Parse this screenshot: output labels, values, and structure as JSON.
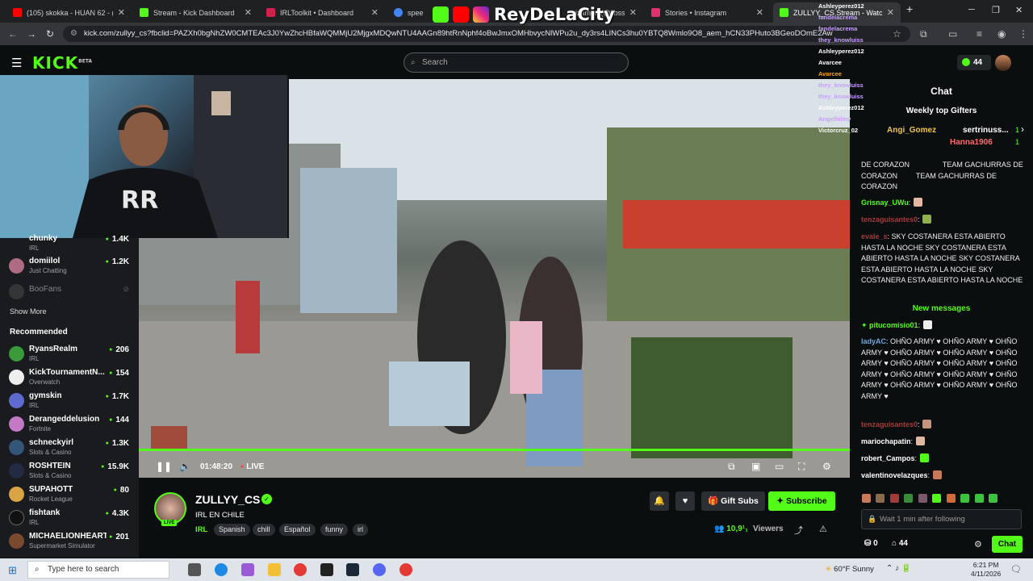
{
  "browser": {
    "tabs": [
      {
        "label": "(105) skokka - HUAN 62 - (Video)",
        "fav_color": "#ff0000",
        "active": false
      },
      {
        "label": "Stream - Kick Dashboard",
        "fav_color": "#53fc18",
        "active": false
      },
      {
        "label": "IRLToolkit • Dashboard",
        "fav_color": "#d1204b",
        "active": false
      },
      {
        "label": "speed t",
        "fav_color": "#4285f4",
        "active": false
      },
      {
        "label": "izamon (@iibss_)",
        "fav_color": "#888888",
        "active": false
      },
      {
        "label": "Stories • Instagram",
        "fav_color": "#e1306c",
        "active": false
      },
      {
        "label": "ZULLYY_CS Stream - Watch",
        "fav_color": "#53fc18",
        "active": true
      }
    ],
    "new_tab": "+",
    "url": "kick.com/zullyy_cs?fbclid=PAZXh0bgNhZW0CMTEAc3J0YwZhcHBfaWQMMjU2MjgxMDQwNTU4AAGn89htRnNphf4oBwJmxOMHbvycNlWPu2u_dy3rs4LINCs3hu0YBTQ8Wmlo9O8_aem_hCN33PHuto3BGeoDOmE2Aw"
  },
  "brand_overlay": {
    "text": "ReyDeLaCity"
  },
  "header": {
    "logo": "KICK",
    "logo_beta": "BETA",
    "search_placeholder": "Search",
    "points": "44"
  },
  "sidebar": {
    "following": [
      {
        "name": "chunky",
        "category": "IRL",
        "viewers": "1.4K",
        "color": "#7a5a3a"
      },
      {
        "name": "domiilol",
        "category": "Just Chatting",
        "viewers": "1.2K",
        "color": "#b06b84"
      },
      {
        "name": "BooFans",
        "category": "",
        "viewers": "",
        "color": "#555555"
      }
    ],
    "show_more": "Show More",
    "recommended_label": "Recommended",
    "recommended": [
      {
        "name": "RyansRealm",
        "category": "IRL",
        "viewers": "206",
        "color": "#3a9b3a"
      },
      {
        "name": "KickTournamentN...",
        "category": "Overwatch",
        "viewers": "154",
        "color": "#ffffff"
      },
      {
        "name": "gymskin",
        "category": "IRL",
        "viewers": "1.7K",
        "color": "#5d6bd1"
      },
      {
        "name": "Derangeddelusion",
        "category": "Fortnite",
        "viewers": "144",
        "color": "#c27ac7"
      },
      {
        "name": "schneckyirl",
        "category": "Slots & Casino",
        "viewers": "1.3K",
        "color": "#335577"
      },
      {
        "name": "ROSHTEIN",
        "category": "Slots & Casino",
        "viewers": "15.9K",
        "color": "#222a44"
      },
      {
        "name": "SUPAHOTT",
        "category": "Rocket League",
        "viewers": "80",
        "color": "#d9a441"
      },
      {
        "name": "fishtank",
        "category": "IRL",
        "viewers": "4.3K",
        "color": "#111111"
      },
      {
        "name": "MICHAELIONHEART",
        "category": "Supermarket Simulator",
        "viewers": "201",
        "color": "#7b4a2e"
      }
    ]
  },
  "player": {
    "time": "01:48:20",
    "live": "LIVE"
  },
  "channel": {
    "name": "ZULLYY_CS",
    "live_badge": "LIVE",
    "title": "IRL EN CHILE",
    "category": "IRL",
    "tags": [
      "Spanish",
      "chill",
      "Español",
      "funny",
      "irl"
    ],
    "gift_label": "Gift Subs",
    "subscribe_label": "Subscribe",
    "viewers": "10,9¹₁",
    "viewers_label": "Viewers"
  },
  "chat": {
    "title": "Chat",
    "gifters_title": "Weekly top Gifters",
    "gifters": [
      {
        "name": "Angi_Gomez",
        "count": "1",
        "color": "#f4c542"
      },
      {
        "name": "sertrinuss...",
        "count": "1",
        "color": "#ffffff"
      },
      {
        "name": "Hanna1906",
        "count": "1",
        "color": "#ff6b6b"
      }
    ],
    "messages_top": [
      {
        "user": "",
        "text": "DE CORAZON      TEAM GACHURRAS DE CORAZON    TEAM GACHURRAS DE CORAZON",
        "color": "#ffffff"
      },
      {
        "user": "Grisnay_UWu",
        "text": "",
        "color": "#53fc18"
      },
      {
        "user": "tenzaguisantes0",
        "text": "",
        "color": "#a33a3a"
      },
      {
        "user": "evale_s",
        "text": ": SKY COSTANERA ESTA ABIERTO HASTA LA NOCHE SKY COSTANERA ESTA ABIERTO HASTA LA NOCHE SKY COSTANERA ESTA ABIERTO HASTA LA NOCHE SKY COSTANERA ESTA ABIERTO HASTA LA NOCHE",
        "color": "#a33a3a"
      }
    ],
    "new_messages": "New messages",
    "messages_bottom": [
      {
        "user": "pitucomisio01",
        "text": ":",
        "color": "#53fc18"
      },
      {
        "user": "ladyAC",
        "text": ": OHÑO ARMY ♥ OHÑO ARMY ♥ OHÑO ARMY ♥ OHÑO ARMY ♥ OHÑO ARMY ♥ OHÑO ARMY ♥ OHÑO ARMY ♥ OHÑO ARMY ♥ OHÑO ARMY ♥ OHÑO ARMY ♥ OHÑO ARMY ♥ OHÑO ARMY ♥ OHÑO ARMY ♥ OHÑO ARMY ♥ OHÑO ARMY ♥",
        "color": "#6fa8dc"
      },
      {
        "user": "tenzaguisantes0",
        "text": ":",
        "color": "#a33a3a"
      },
      {
        "user": "mariochapatin",
        "text": ":",
        "color": "#ffffff"
      },
      {
        "user": "robert_Campos",
        "text": ":",
        "color": "#ffffff"
      },
      {
        "user": "valentinovelazques",
        "text": ":",
        "color": "#ffffff"
      }
    ],
    "input_placeholder": "Wait 1 min after following",
    "points": "0",
    "count": "44",
    "send_label": "Chat"
  },
  "overlay_chat": [
    {
      "user": "Ashleyperez012",
      "color": "#ffffff"
    },
    {
      "user": "fandelacrema",
      "color": "#c9a0ff"
    },
    {
      "user": "fandelacrema",
      "color": "#c9a0ff"
    },
    {
      "user": "they_knowluiss",
      "color": "#c9a0ff"
    },
    {
      "user": "Ashleyperez012",
      "color": "#ffffff"
    },
    {
      "user": "Avarcee",
      "color": "#ffffff"
    },
    {
      "user": "Avarcee",
      "color": "#ffa500"
    },
    {
      "user": "they_knowluiss",
      "color": "#c9a0ff"
    },
    {
      "user": "they_knowluiss",
      "color": "#c9a0ff"
    },
    {
      "user": "Ashleyperez012",
      "color": "#ffffff"
    },
    {
      "user": "Angelhilmy",
      "color": "#c9a0ff"
    },
    {
      "user": "Victorcruz_02",
      "color": "#ffffff"
    }
  ],
  "taskbar": {
    "search_placeholder": "Type here to search",
    "weather": "60°F Sunny",
    "time": "6:21 PM",
    "date": "4/11/2026"
  }
}
